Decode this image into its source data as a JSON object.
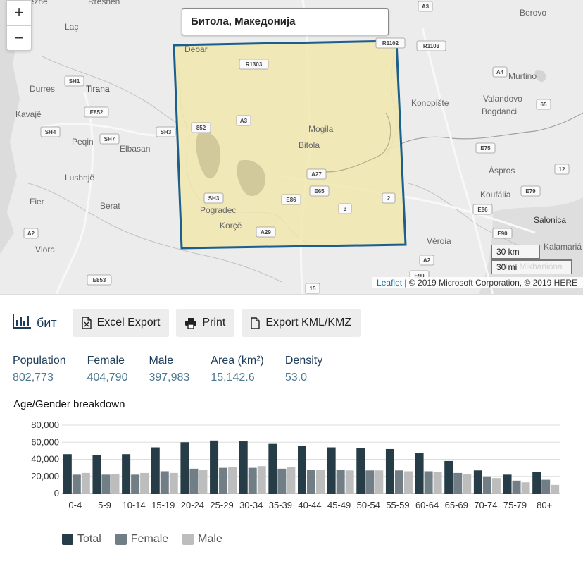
{
  "map": {
    "search_value": "Битола, Македонија",
    "zoom_in": "+",
    "zoom_out": "−",
    "scale_km": "30 km",
    "scale_mi": "30 mi",
    "attribution_link": "Leaflet",
    "attribution_text": " | © 2019 Microsoft Corporation, © 2019 HERE",
    "place_labels": [
      "Lezhë",
      "Rreshen",
      "Laç",
      "Durres",
      "Tirana",
      "Kavajë",
      "Peqin",
      "Elbasan",
      "Lushnjë",
      "Fier",
      "Berat",
      "Vlora",
      "Debar",
      "Pogradec",
      "Korçë",
      "Mogila",
      "Bitola",
      "Berovo",
      "Murtino",
      "Valandovo",
      "Konopište",
      "Bogdanci",
      "Áspros",
      "Koufália",
      "Salonica",
      "Kalamariá",
      "Véroia",
      "Néa Mikhanióna"
    ],
    "road_labels": [
      "SH1",
      "E852",
      "SH4",
      "SH7",
      "SH3",
      "SH3",
      "A2",
      "E853",
      "R1303",
      "A3",
      "852",
      "A27",
      "E65",
      "E86",
      "3",
      "2",
      "A29",
      "R1102",
      "R1103",
      "A3",
      "A4",
      "65",
      "E75",
      "12",
      "E79",
      "E86",
      "E90",
      "A2",
      "E90",
      "15"
    ],
    "colors": {
      "land": "#ececec",
      "water": "#dedede",
      "border": "#9a9a9a",
      "highlight_fill": "#f2e8b3",
      "highlight_stroke": "#1b5f8c"
    }
  },
  "toolbar": {
    "title": "бит",
    "title_icon": "bar-chart-icon",
    "excel_label": "Excel Export",
    "print_label": "Print",
    "kml_label": "Export KML/KMZ"
  },
  "stats": [
    {
      "label": "Population",
      "value": "802,773"
    },
    {
      "label": "Female",
      "value": "404,790"
    },
    {
      "label": "Male",
      "value": "397,983"
    },
    {
      "label": "Area (km²)",
      "value": "15,142.6"
    },
    {
      "label": "Density",
      "value": "53.0"
    }
  ],
  "section_title": "Age/Gender breakdown",
  "chart_data": {
    "type": "bar",
    "title": "Age/Gender breakdown",
    "categories": [
      "0-4",
      "5-9",
      "10-14",
      "15-19",
      "20-24",
      "25-29",
      "30-34",
      "35-39",
      "40-44",
      "45-49",
      "50-54",
      "55-59",
      "60-64",
      "65-69",
      "70-74",
      "75-79",
      "80+"
    ],
    "category_labels": [
      "0-4",
      "5-9",
      "10-14",
      "15-19",
      "20-24",
      "25-29",
      "30-34",
      "35-39",
      "40-44",
      "45-49",
      "50-54",
      "55-59",
      "60-64",
      "65-69",
      "70-74",
      "75-79",
      "80+"
    ],
    "series": [
      {
        "name": "Total",
        "color": "#263c46",
        "values": [
          46000,
          45000,
          46000,
          54000,
          60000,
          62000,
          61000,
          58000,
          56000,
          54000,
          53000,
          52000,
          47000,
          38000,
          27000,
          22000,
          25000
        ]
      },
      {
        "name": "Female",
        "color": "#717e86",
        "values": [
          22000,
          22000,
          22000,
          26000,
          29000,
          30000,
          30000,
          29000,
          28000,
          28000,
          27000,
          27000,
          26000,
          24000,
          20000,
          15000,
          16000
        ]
      },
      {
        "name": "Male",
        "color": "#bdbdbd",
        "values": [
          24000,
          23000,
          24000,
          24000,
          28000,
          31000,
          32000,
          31000,
          28000,
          27000,
          27000,
          26000,
          25000,
          23000,
          18000,
          13000,
          10000
        ]
      }
    ],
    "y_ticks": [
      "0",
      "20,000",
      "40,000",
      "60,000",
      "80,000"
    ],
    "ylim": [
      0,
      80000
    ],
    "grid": true,
    "legend": "bottom-left"
  }
}
